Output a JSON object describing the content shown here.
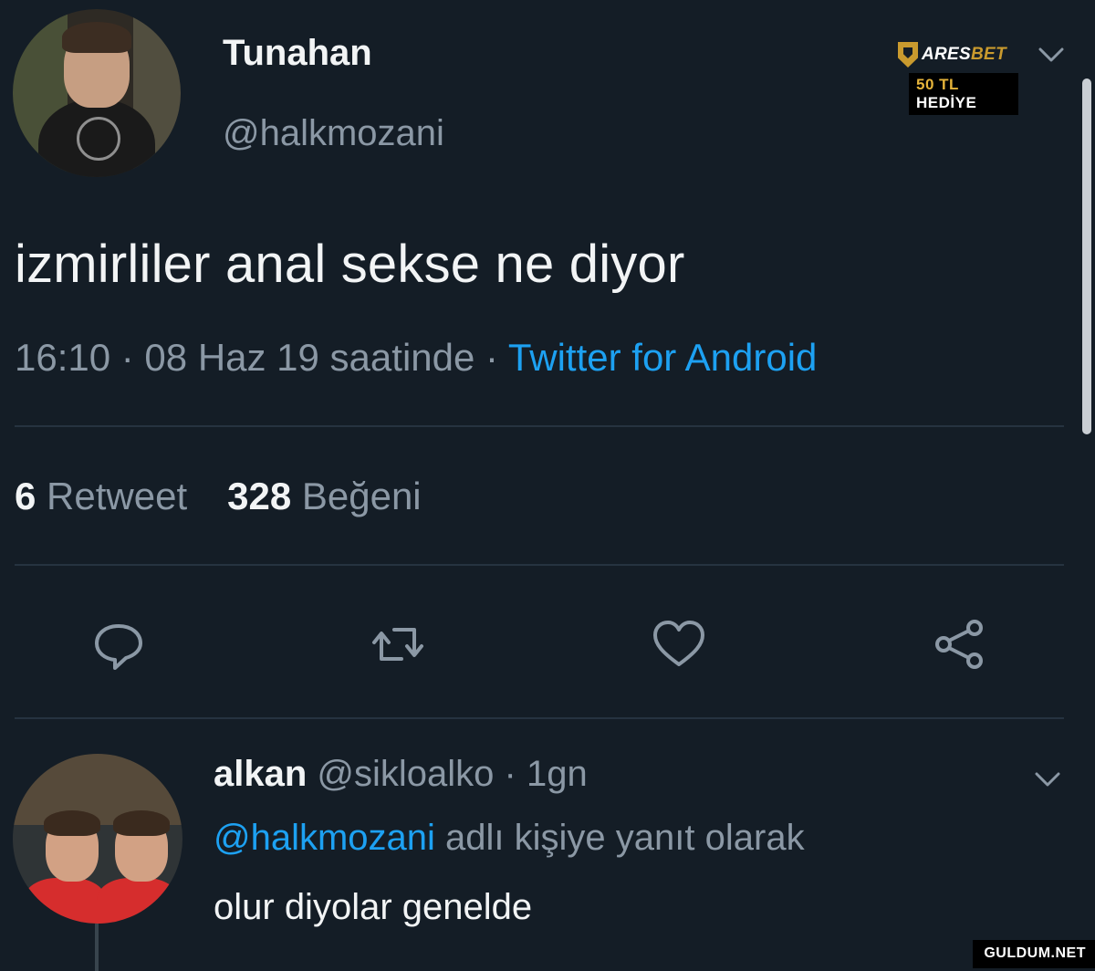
{
  "tweet": {
    "display_name": "Tunahan",
    "handle": "@halkmozani",
    "text": "izmirliler anal sekse ne diyor",
    "time": "16:10 · 08 Haz 19 saatinde · ",
    "source": "Twitter for Android",
    "stats": {
      "retweet_count": "6",
      "retweet_label": "Retweet",
      "like_count": "328",
      "like_label": "Beğeni"
    },
    "actions": {
      "reply_icon": "reply-icon",
      "retweet_icon": "retweet-icon",
      "like_icon": "heart-icon",
      "share_icon": "share-icon"
    }
  },
  "ad": {
    "brand_prefix": "ARES",
    "brand_accent": "BET",
    "gift_number": "50 TL",
    "gift_word": "HEDİYE",
    "accent_color": "#c99a2e"
  },
  "reply": {
    "display_name": "alkan",
    "handle_time": " @sikloalko · 1gn",
    "mention": "@halkmozani",
    "context": " adlı kişiye yanıt olarak",
    "text": "olur diyolar genelde"
  },
  "watermark": "GULDUM.NET",
  "colors": {
    "background": "#141d26",
    "link": "#1da1f2",
    "muted": "#8b98a5"
  }
}
